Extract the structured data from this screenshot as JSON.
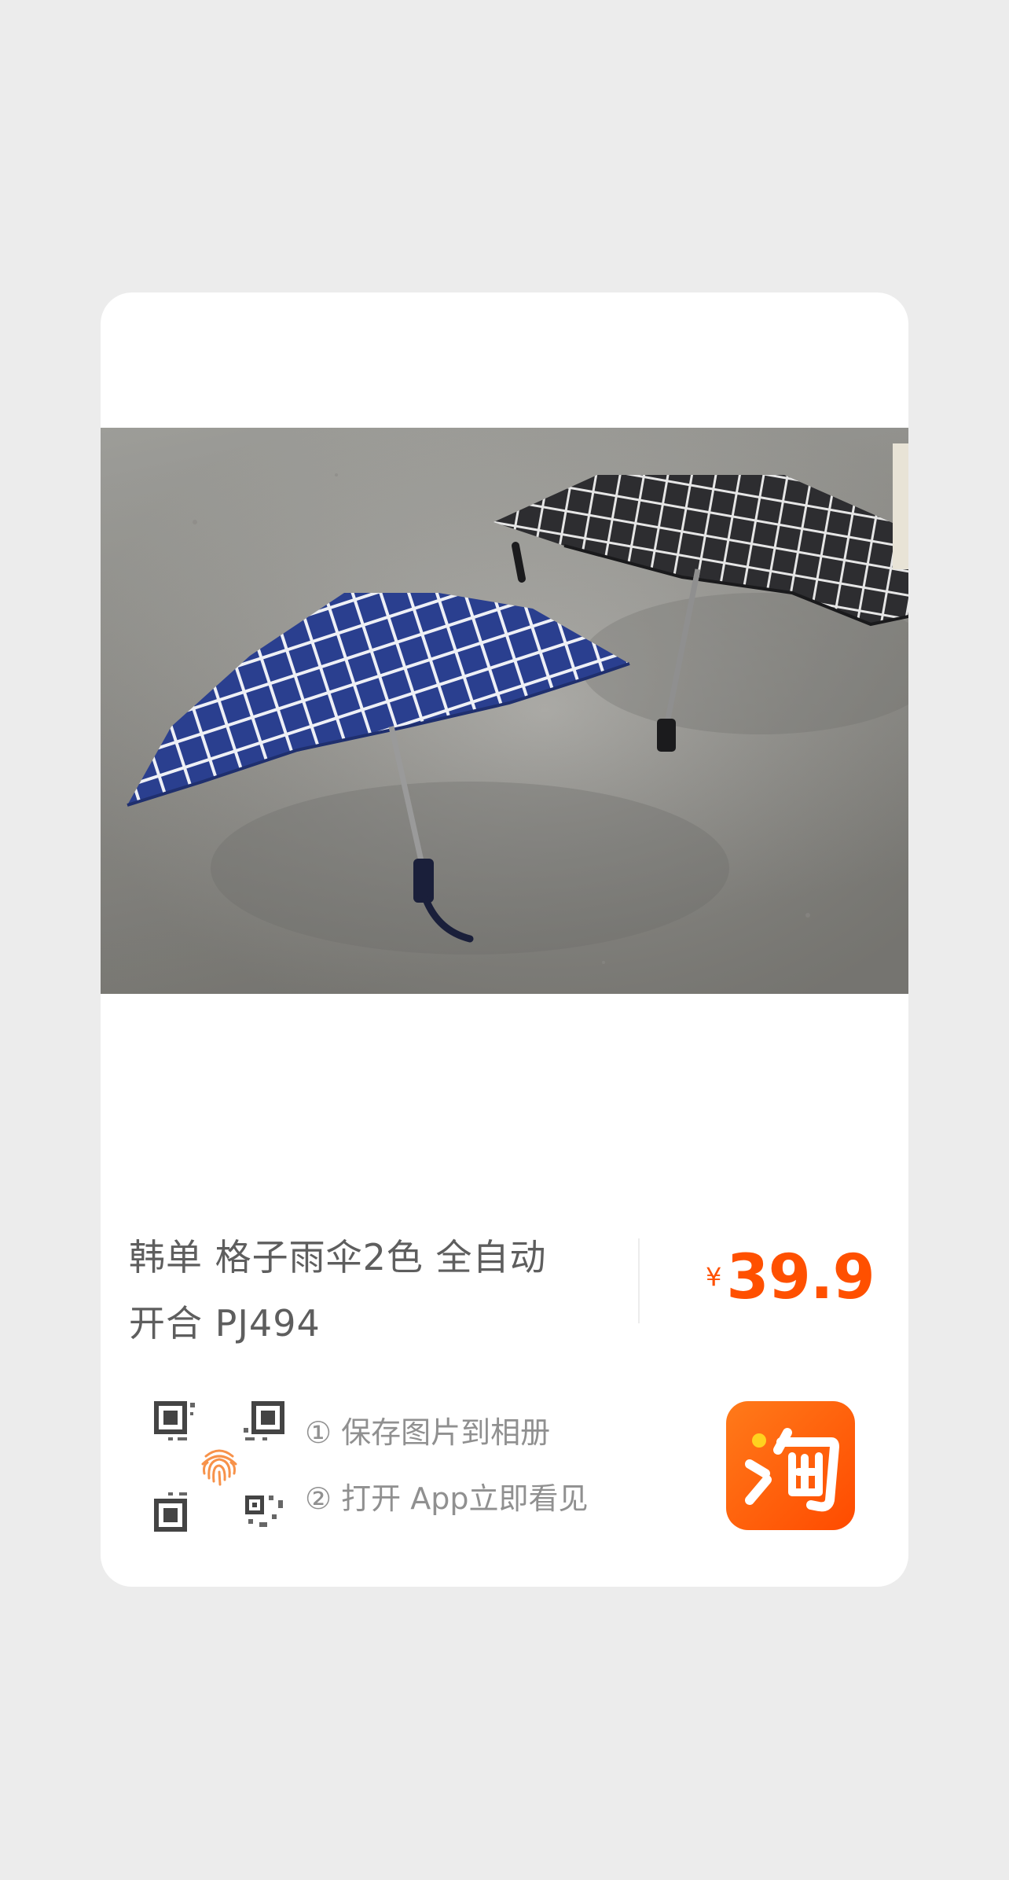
{
  "product": {
    "title_line1": "韩单 格子雨伞2色 全自动",
    "title_line2": "开合 PJ494",
    "currency_symbol": "¥",
    "price": "39.9",
    "image_alt": "两把格子折叠雨伞，一把蓝色一把黑色"
  },
  "share": {
    "step1": "① 保存图片到相册",
    "step2": "② 打开 App立即看见",
    "app_icon": "taobao-logo-icon",
    "qr_icon": "qr-code-icon",
    "fingerprint_icon": "fingerprint-icon"
  },
  "colors": {
    "price": "#ff5000",
    "app_icon_bg": "#ff5a00",
    "background": "#ececec",
    "card": "#ffffff"
  }
}
